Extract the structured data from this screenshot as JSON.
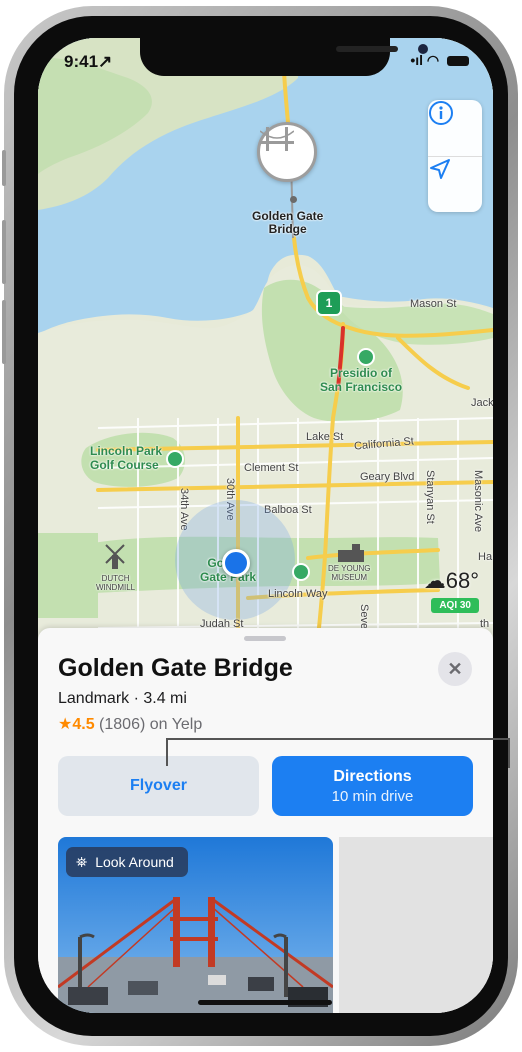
{
  "status_bar": {
    "time": "9:41",
    "location_arrow": "↗",
    "signal": "•ıl",
    "wifi": "◠"
  },
  "map_controls": {
    "info_icon": "info-icon",
    "location_icon": "location-arrow-icon"
  },
  "map": {
    "pin_label": "Golden Gate\nBridge",
    "route_number": "1",
    "labels": {
      "mason_st": "Mason St",
      "presidio": "Presidio of\nSan Francisco",
      "jackson": "Jack",
      "lake_st": "Lake St",
      "california_st": "California St",
      "lincoln_park": "Lincoln Park\nGolf Course",
      "clement_st": "Clement St",
      "geary_blvd": "Geary Blvd",
      "ave_34": "34th Ave",
      "ave_30": "30th Ave",
      "balboa_st": "Balboa St",
      "stanyan_st": "Stanyan St",
      "masonic_ave": "Masonic Ave",
      "golden_gate_park": "Golden\nGate Park",
      "de_young": "DE YOUNG\nMUSEUM",
      "dutch_windmill": "DUTCH\nWINDMILL",
      "lincoln_way": "Lincoln Way",
      "judah_st": "Judah St",
      "seventh": "Seven",
      "ha": "Ha",
      "th": "th"
    }
  },
  "weather": {
    "temp": "68°",
    "aqi": "AQI 30"
  },
  "place": {
    "title": "Golden Gate Bridge",
    "subtitle": "Landmark · 3.4 mi",
    "star": "★",
    "score": "4.5",
    "reviews": " (1806) on Yelp"
  },
  "actions": {
    "flyover": "Flyover",
    "directions": "Directions",
    "directions_sub": "10 min drive"
  },
  "look_around": {
    "label": "Look Around"
  },
  "colors": {
    "accent": "#1c7ff2",
    "rating": "#ff8a00",
    "aqi": "#2ebd59",
    "water": "#a8d2ec",
    "park": "#c3e0b0"
  }
}
